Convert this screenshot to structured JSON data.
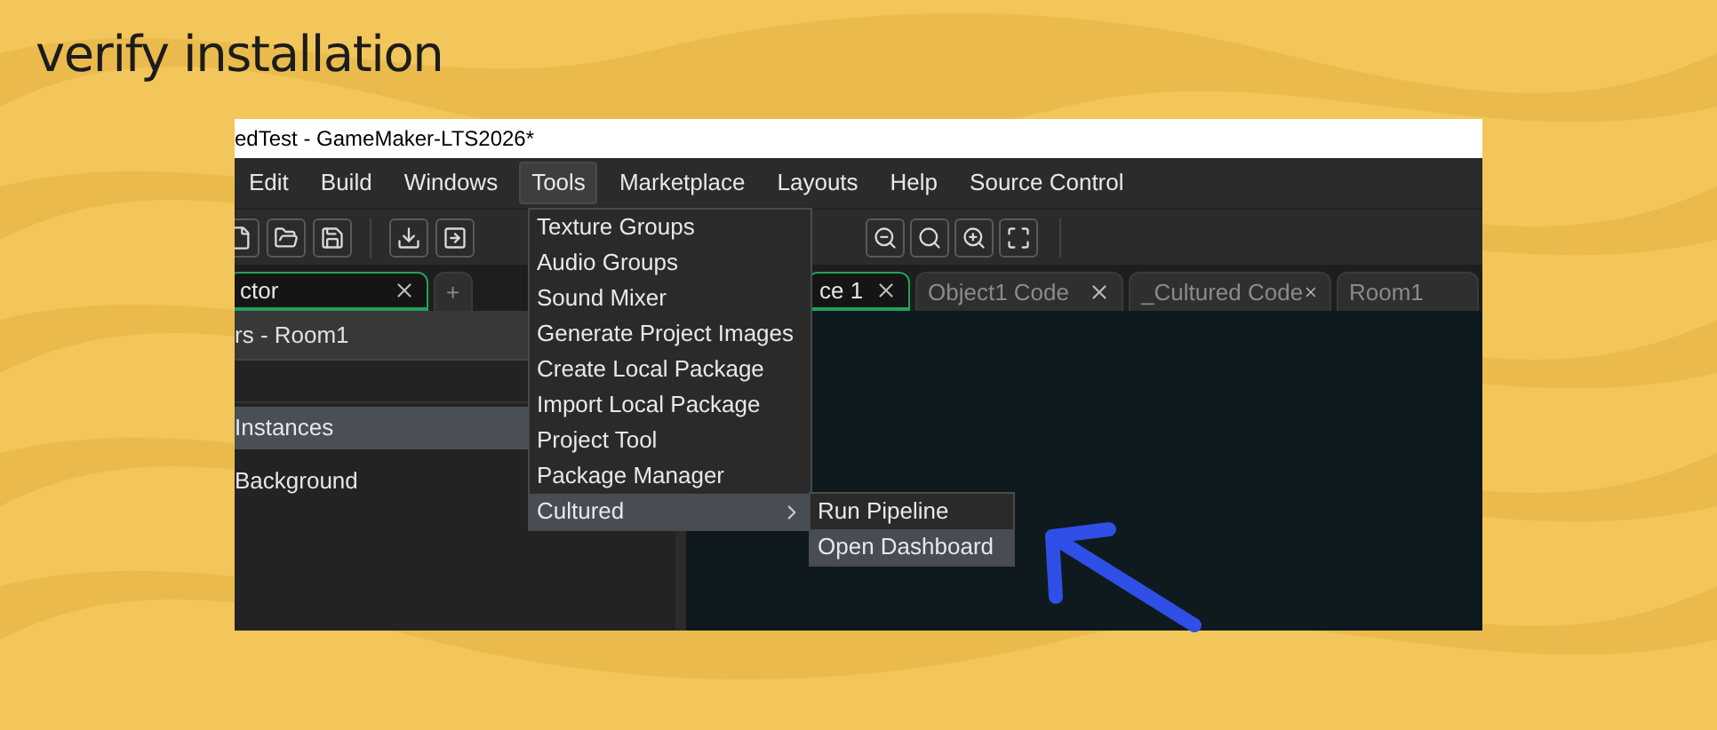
{
  "heading": "verify installation",
  "window": {
    "title": "edTest - GameMaker-LTS2026*"
  },
  "menu_bar": [
    {
      "label": "Edit",
      "selected": false
    },
    {
      "label": "Build",
      "selected": false
    },
    {
      "label": "Windows",
      "selected": false
    },
    {
      "label": "Tools",
      "selected": true
    },
    {
      "label": "Marketplace",
      "selected": false
    },
    {
      "label": "Layouts",
      "selected": false
    },
    {
      "label": "Help",
      "selected": false
    },
    {
      "label": "Source Control",
      "selected": false
    }
  ],
  "left_tabs": [
    {
      "label": "ctor",
      "selected": true,
      "closable": true
    },
    {
      "label": "+",
      "selected": false,
      "closable": false
    }
  ],
  "panel": {
    "header": "rs - Room1",
    "layers": [
      {
        "label": "Instances",
        "selected": true
      },
      {
        "label": "Background",
        "selected": false
      }
    ]
  },
  "editor_tabs": [
    {
      "label": "ce 1",
      "selected": true,
      "closable": true
    },
    {
      "label": "Object1 Code",
      "selected": false,
      "closable": true
    },
    {
      "label": "_Cultured Code",
      "selected": false,
      "closable": true
    },
    {
      "label": "Room1",
      "selected": false,
      "closable": false
    }
  ],
  "tools_menu": {
    "items": [
      {
        "label": "Texture Groups",
        "selected": false,
        "has_submenu": false
      },
      {
        "label": "Audio Groups",
        "selected": false,
        "has_submenu": false
      },
      {
        "label": "Sound Mixer",
        "selected": false,
        "has_submenu": false
      },
      {
        "label": "Generate Project Images",
        "selected": false,
        "has_submenu": false
      },
      {
        "label": "Create Local Package",
        "selected": false,
        "has_submenu": false
      },
      {
        "label": "Import Local Package",
        "selected": false,
        "has_submenu": false
      },
      {
        "label": "Project Tool",
        "selected": false,
        "has_submenu": false
      },
      {
        "label": "Package Manager",
        "selected": false,
        "has_submenu": false
      },
      {
        "label": "Cultured",
        "selected": true,
        "has_submenu": true
      }
    ]
  },
  "submenu": {
    "items": [
      {
        "label": "Run Pipeline",
        "selected": false
      },
      {
        "label": "Open Dashboard",
        "selected": true
      }
    ]
  }
}
